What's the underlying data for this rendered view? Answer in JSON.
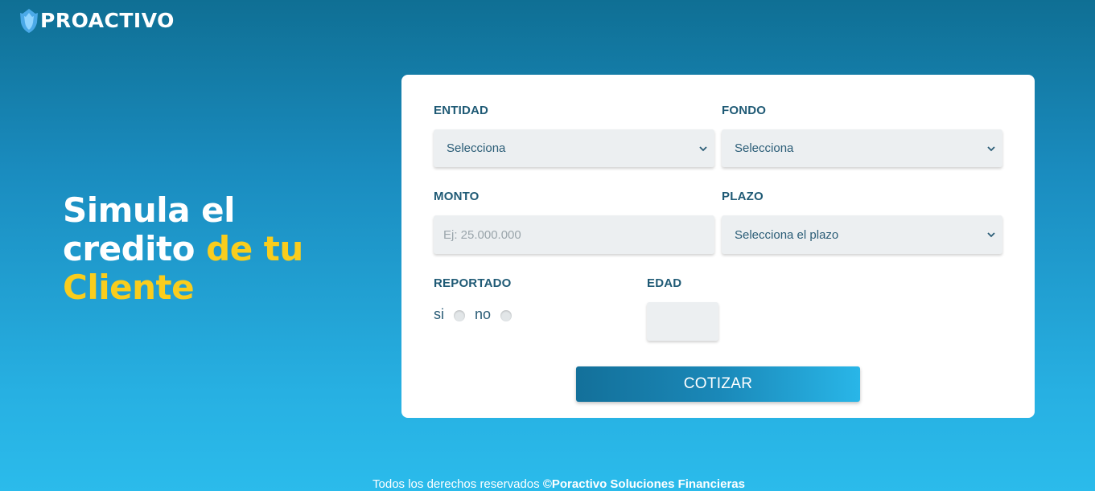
{
  "brand": {
    "name": "PROACTIVO",
    "icon": "shield-flame-icon",
    "icon_color": "#5fb8f0"
  },
  "hero": {
    "line1": "Simula el",
    "line2_white": "credito",
    "line2_accent": "de tu",
    "line3_accent": "Cliente",
    "accent_color": "#f9cd1d"
  },
  "form": {
    "entidad": {
      "label": "ENTIDAD",
      "value": "Selecciona"
    },
    "fondo": {
      "label": "FONDO",
      "value": "Selecciona"
    },
    "monto": {
      "label": "MONTO",
      "placeholder": "Ej: 25.000.000"
    },
    "plazo": {
      "label": "PLAZO",
      "value": "Selecciona el plazo"
    },
    "reportado": {
      "label": "REPORTADO",
      "options": [
        "si",
        "no"
      ]
    },
    "edad": {
      "label": "EDAD",
      "value": ""
    },
    "submit_label": "COTIZAR"
  },
  "footer": {
    "text": "Todos los derechos reservados",
    "company": "©Poractivo Soluciones Financieras"
  },
  "colors": {
    "label": "#1f5a75",
    "field_bg": "#eceff1",
    "button": "#13709a"
  }
}
